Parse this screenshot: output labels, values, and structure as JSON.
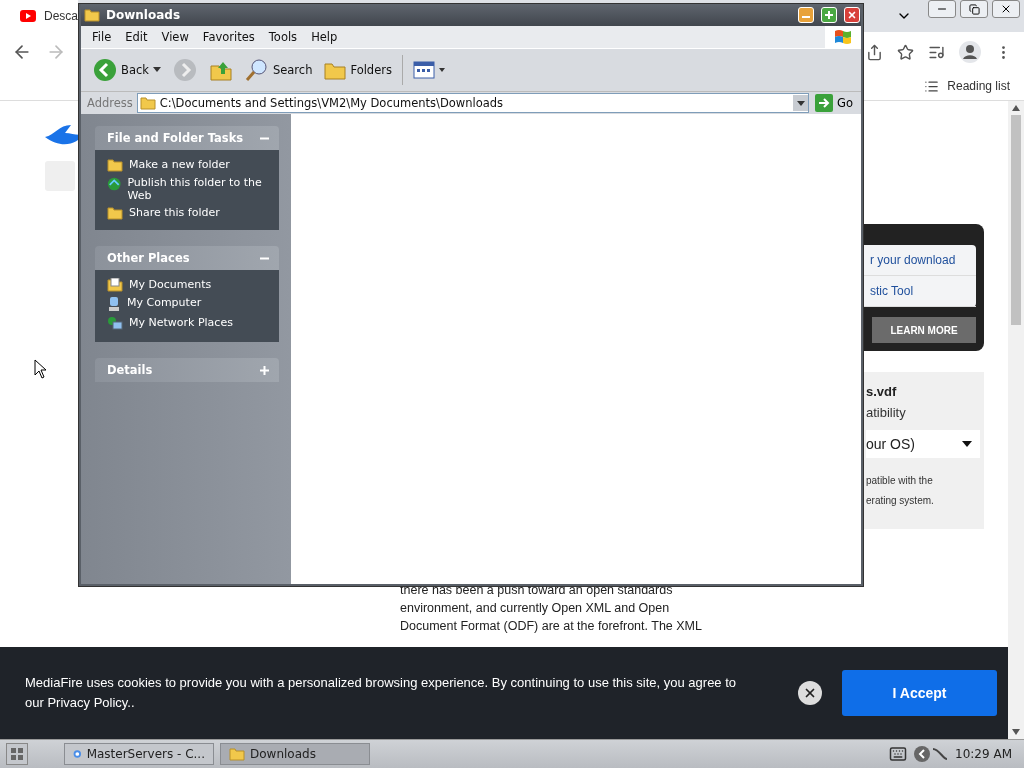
{
  "browser": {
    "tab": {
      "title": "Desca"
    },
    "reading_list": "Reading list"
  },
  "page": {
    "article_lines": [
      "there has been a push toward an open standards",
      "environment, and currently Open XML and Open",
      "Document Format (ODF) are at the forefront. The XML"
    ],
    "download_card": {
      "links": [
        "r your download",
        "stic Tool"
      ],
      "button": "LEARN MORE"
    },
    "file_card": {
      "filename": "s.vdf",
      "label": "atibility",
      "select": "our OS)",
      "note_lines": [
        "patible with the",
        "erating system."
      ]
    }
  },
  "explorer": {
    "title": "Downloads",
    "menu": [
      "File",
      "Edit",
      "View",
      "Favorites",
      "Tools",
      "Help"
    ],
    "toolbar": [
      {
        "kind": "back",
        "label": "Back"
      },
      {
        "kind": "forward"
      },
      {
        "kind": "up"
      },
      {
        "kind": "search",
        "label": "Search"
      },
      {
        "kind": "folders",
        "label": "Folders"
      },
      {
        "kind": "views"
      }
    ],
    "address": {
      "label": "Address",
      "value": "C:\\Documents and Settings\\VM2\\My Documents\\Downloads",
      "go": "Go"
    },
    "panels": [
      {
        "title": "File and Folder Tasks",
        "expanded": true,
        "items": [
          {
            "kind": "newfolder",
            "label": "Make a new folder"
          },
          {
            "kind": "web",
            "label": "Publish this folder to the Web"
          },
          {
            "kind": "share",
            "label": "Share this folder"
          }
        ]
      },
      {
        "title": "Other Places",
        "expanded": true,
        "items": [
          {
            "kind": "documents",
            "label": "My Documents"
          },
          {
            "kind": "computer",
            "label": "My Computer"
          },
          {
            "kind": "network",
            "label": "My Network Places"
          }
        ]
      },
      {
        "title": "Details",
        "expanded": false
      }
    ]
  },
  "cookie_banner": {
    "text": "MediaFire uses cookies to provide you with a personalized browsing experience. By continuing to use this site, you agree to our Privacy Policy..",
    "button": "I Accept"
  },
  "taskbar": {
    "items": [
      {
        "kind": "browser",
        "label": "MasterServers - C...",
        "selected": false
      },
      {
        "kind": "folder",
        "label": "Downloads",
        "selected": true
      }
    ],
    "clock": "10:29 AM"
  }
}
